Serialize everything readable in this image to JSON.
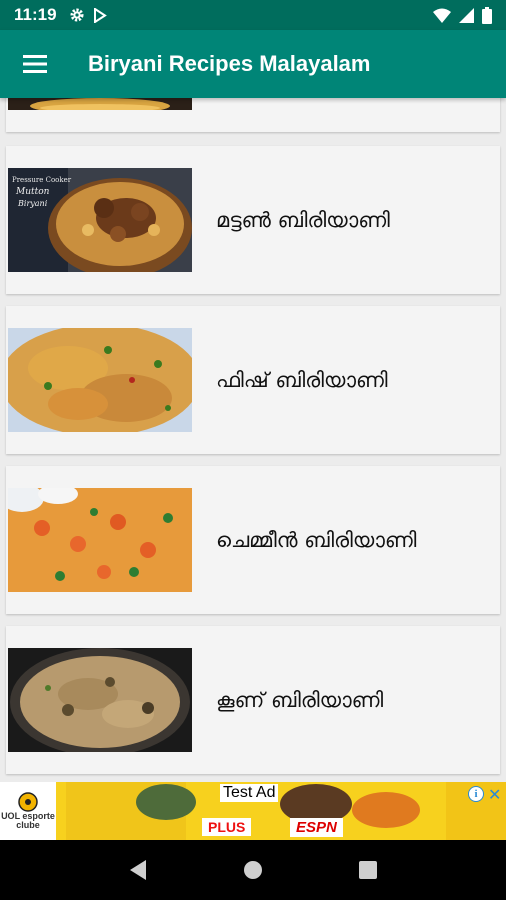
{
  "status_bar": {
    "time": "11:19",
    "icons": [
      "gear-icon",
      "play-store-icon",
      "wifi-icon",
      "signal-icon",
      "battery-icon"
    ]
  },
  "app_bar": {
    "title": "Biryani Recipes Malayalam",
    "menu_icon": "hamburger-menu-icon",
    "color": "#008577"
  },
  "recipes": [
    {
      "title": "",
      "thumb": "partial-biryani-image"
    },
    {
      "title": "മട്ടൺ ബിരിയാണി",
      "thumb": "mutton-biryani-image"
    },
    {
      "title": "ഫിഷ് ബിരിയാണി",
      "thumb": "fish-biryani-image"
    },
    {
      "title": "ചെമ്മീൻ ബിരിയാണി",
      "thumb": "prawn-biryani-image"
    },
    {
      "title": "കൂണ് ബിരിയാണി",
      "thumb": "mushroom-biryani-image"
    }
  ],
  "ad": {
    "label": "Test Ad",
    "logo_text": "UOL esporte clube",
    "brand_1": "PLUS",
    "brand_2": "ESPN",
    "info_glyph": "i",
    "close_glyph": "✕"
  },
  "nav_bar": {
    "buttons": [
      "back-icon",
      "home-icon",
      "recents-icon"
    ]
  }
}
